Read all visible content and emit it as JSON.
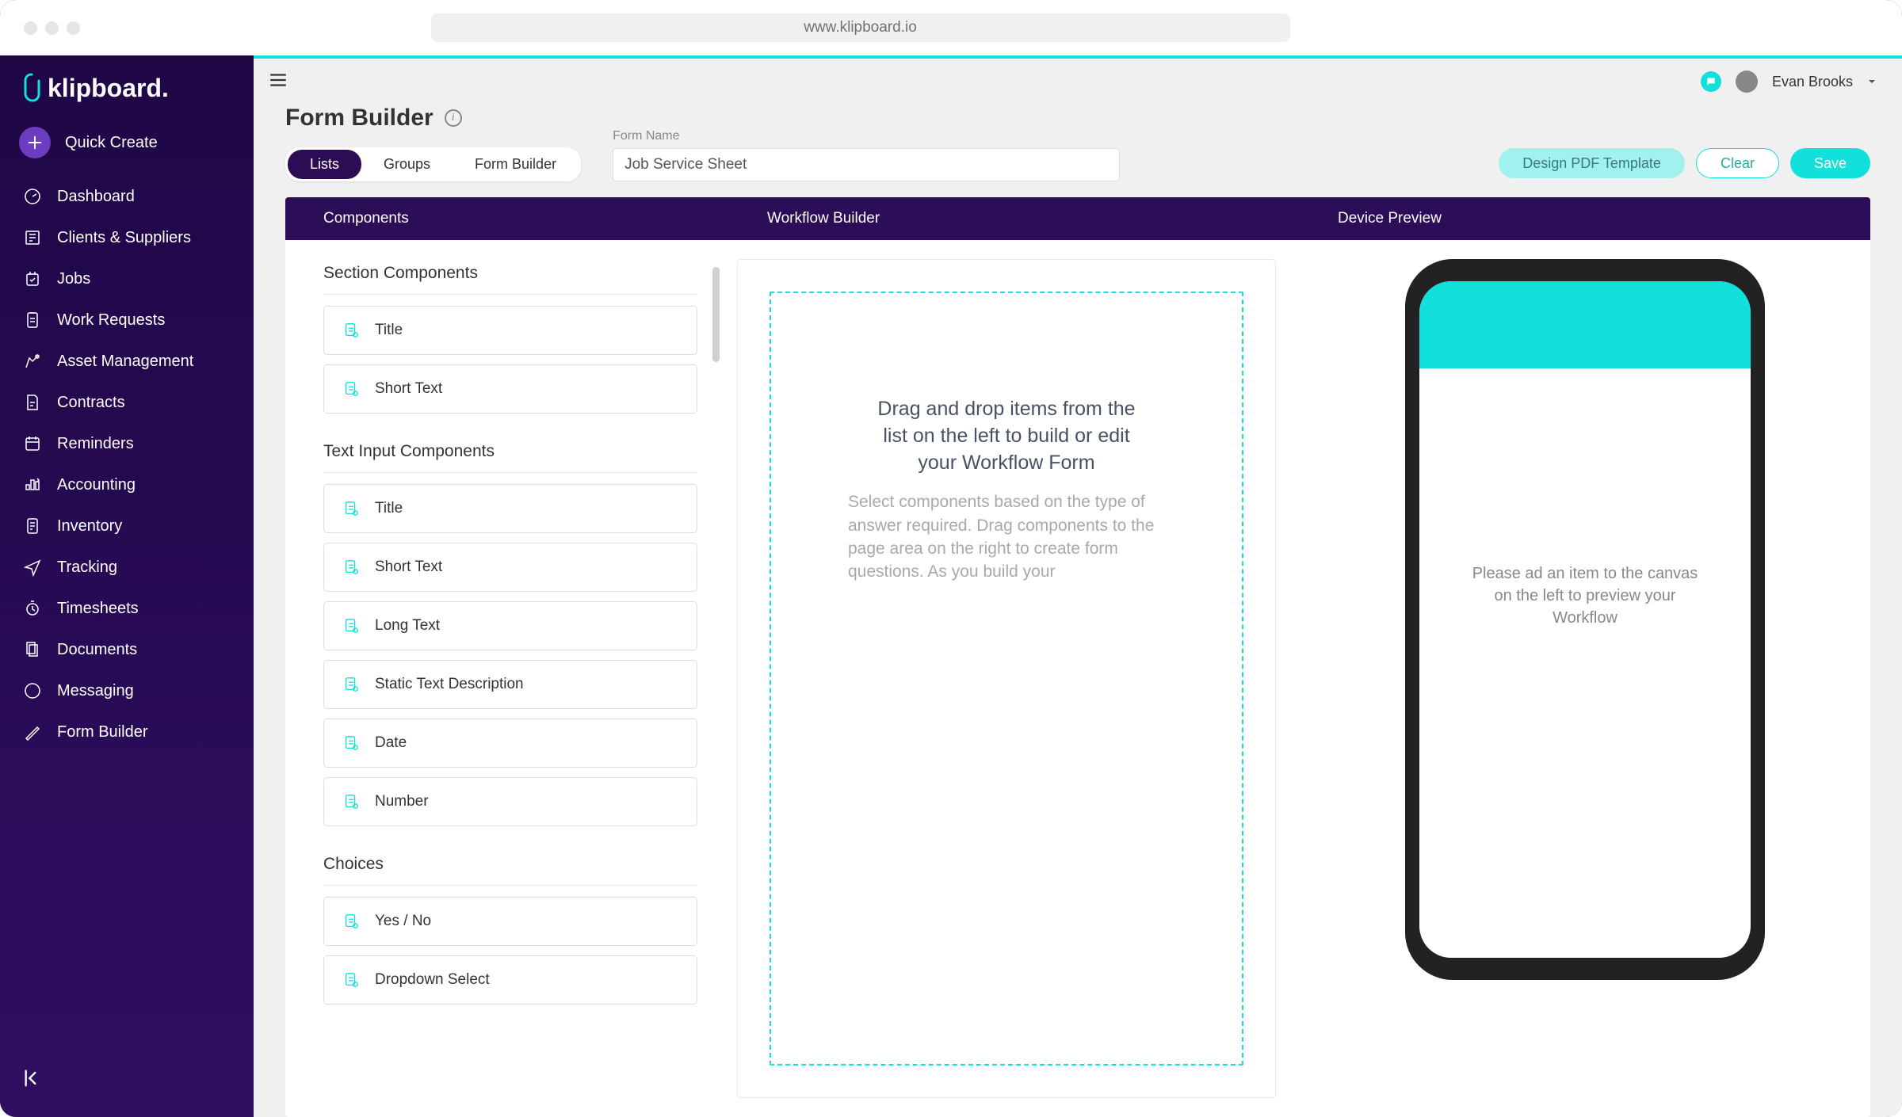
{
  "browser_url": "www.klipboard.io",
  "logo_text": "klipboard.",
  "quick_create_label": "Quick Create",
  "user_name": "Evan Brooks",
  "sidebar": [
    {
      "icon": "dashboard",
      "label": "Dashboard"
    },
    {
      "icon": "clients",
      "label": "Clients & Suppliers"
    },
    {
      "icon": "jobs",
      "label": "Jobs"
    },
    {
      "icon": "workrequests",
      "label": "Work Requests"
    },
    {
      "icon": "assets",
      "label": "Asset Management"
    },
    {
      "icon": "contracts",
      "label": "Contracts"
    },
    {
      "icon": "reminders",
      "label": "Reminders"
    },
    {
      "icon": "accounting",
      "label": "Accounting"
    },
    {
      "icon": "inventory",
      "label": "Inventory"
    },
    {
      "icon": "tracking",
      "label": "Tracking"
    },
    {
      "icon": "timesheets",
      "label": "Timesheets"
    },
    {
      "icon": "documents",
      "label": "Documents"
    },
    {
      "icon": "messaging",
      "label": "Messaging"
    },
    {
      "icon": "formbuilder",
      "label": "Form Builder"
    }
  ],
  "header": {
    "title": "Form Builder",
    "tabs": [
      "Lists",
      "Groups",
      "Form Builder"
    ],
    "form_name_label": "Form Name",
    "form_name_value": "Job Service Sheet",
    "design_btn": "Design PDF Template",
    "clear_btn": "Clear",
    "save_btn": "Save"
  },
  "builder_headers": {
    "components": "Components",
    "workflow": "Workflow Builder",
    "preview": "Device Preview"
  },
  "components": {
    "sections": [
      {
        "title": "Section Components",
        "items": [
          "Title",
          "Short Text"
        ]
      },
      {
        "title": "Text Input Components",
        "items": [
          "Title",
          "Short Text",
          "Long Text",
          "Static Text Description",
          "Date",
          "Number"
        ]
      },
      {
        "title": "Choices",
        "items": [
          "Yes / No",
          "Dropdown Select"
        ]
      }
    ]
  },
  "workflow": {
    "dropzone_title": "Drag and drop items from the list on the left to build or edit your Workflow Form",
    "dropzone_desc": "Select components based on the type of answer required. Drag components to the page area on the right to create form questions. As you build your"
  },
  "preview_hint": "Please ad an item to the canvas on the left to preview your Workflow"
}
